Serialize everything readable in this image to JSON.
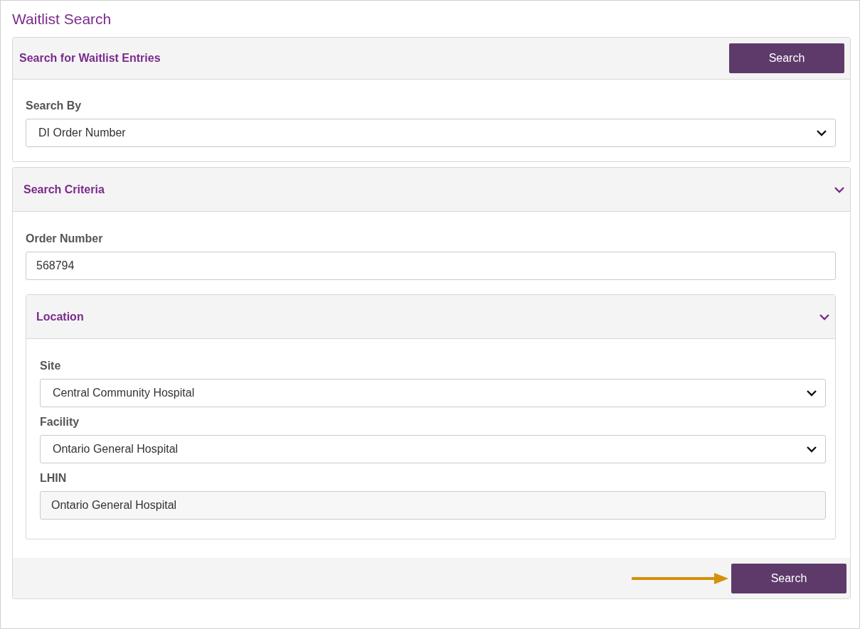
{
  "page_title": "Waitlist Search",
  "search_panel": {
    "title": "Search for Waitlist Entries",
    "button": "Search",
    "fields": [
      {
        "kind": "select",
        "label": "Search By",
        "value": "DI Order Number"
      }
    ]
  },
  "criteria_panel": {
    "title": "Search Criteria",
    "expanded": true,
    "fields": [
      {
        "kind": "input",
        "label": "Order Number",
        "value": "568794"
      }
    ],
    "location": {
      "title": "Location",
      "expanded": true,
      "fields": [
        {
          "kind": "select",
          "label": "Site",
          "value": "Central Community Hospital"
        },
        {
          "kind": "select",
          "label": "Facility",
          "value": "Ontario General Hospital"
        },
        {
          "kind": "readonly",
          "label": "LHIN",
          "value": "Ontario General Hospital"
        }
      ]
    },
    "footer_button": "Search"
  }
}
